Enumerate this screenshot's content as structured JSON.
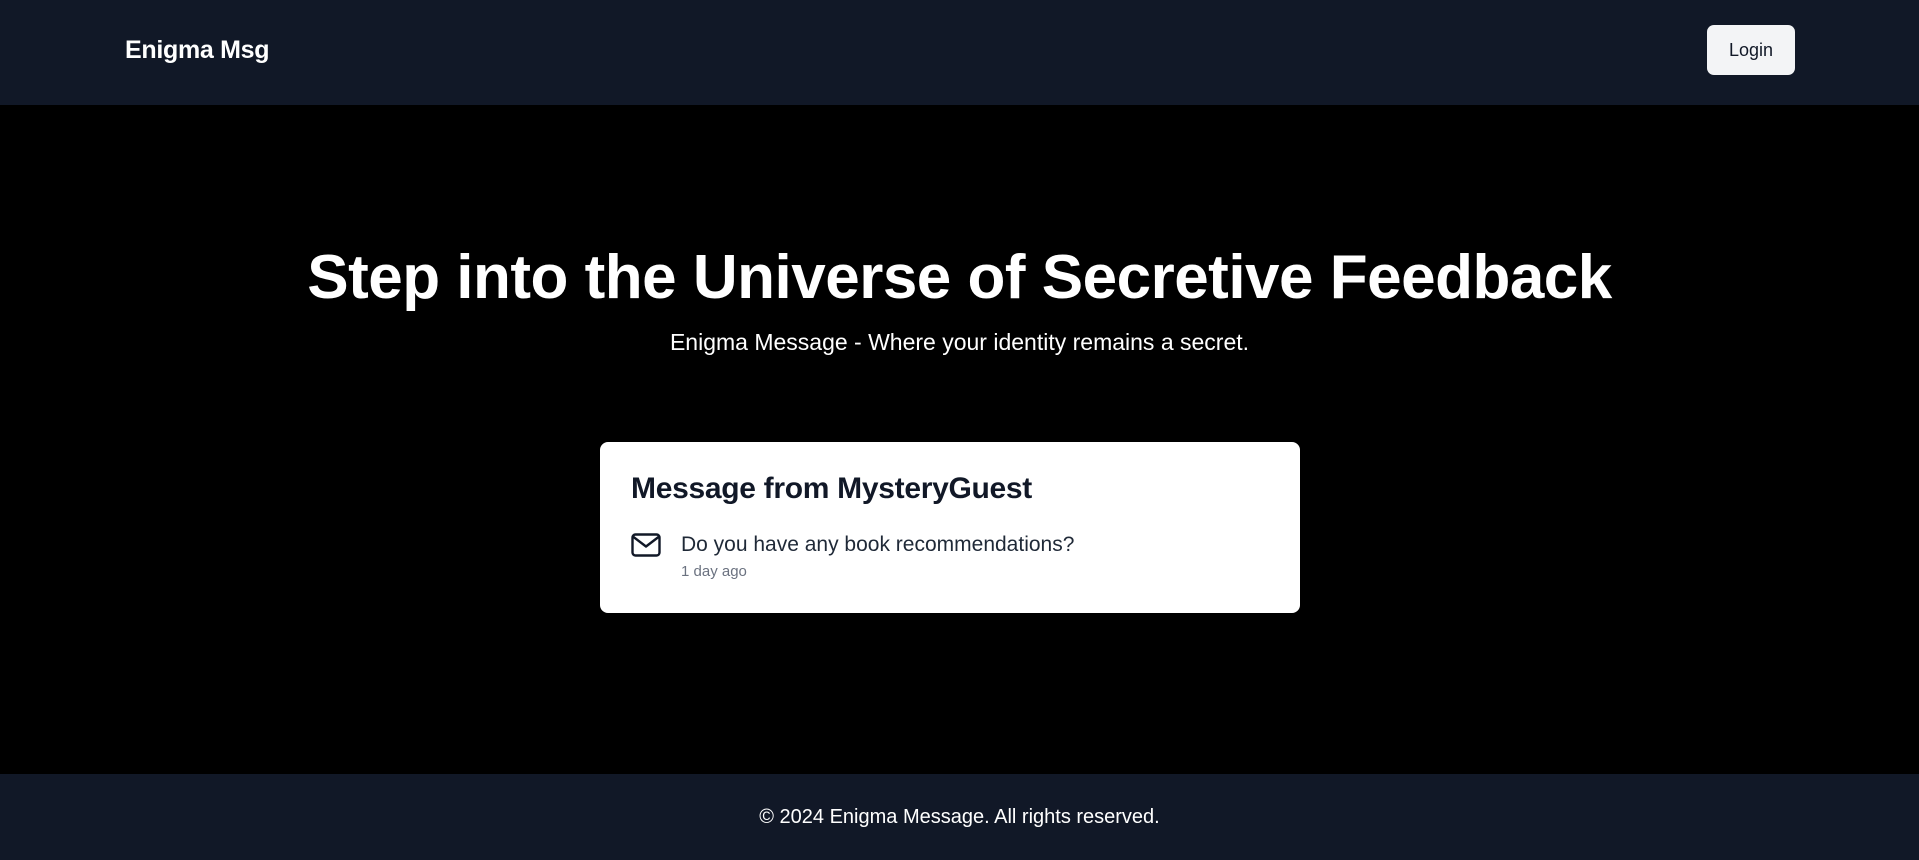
{
  "header": {
    "brand": "Enigma Msg",
    "login_label": "Login"
  },
  "hero": {
    "title": "Step into the Universe of Secretive Feedback",
    "subtitle": "Enigma Message - Where your identity remains a secret."
  },
  "message_card": {
    "title": "Message from MysteryGuest",
    "icon": "mail-icon",
    "content": "Do you have any book recommendations?",
    "time": "1 day ago"
  },
  "footer": {
    "copyright": "© 2024 Enigma Message. All rights reserved."
  },
  "colors": {
    "nav_background": "#111827",
    "page_background": "#000000",
    "card_background": "#ffffff",
    "button_background": "#f3f4f6",
    "muted_text": "#6b7280"
  }
}
